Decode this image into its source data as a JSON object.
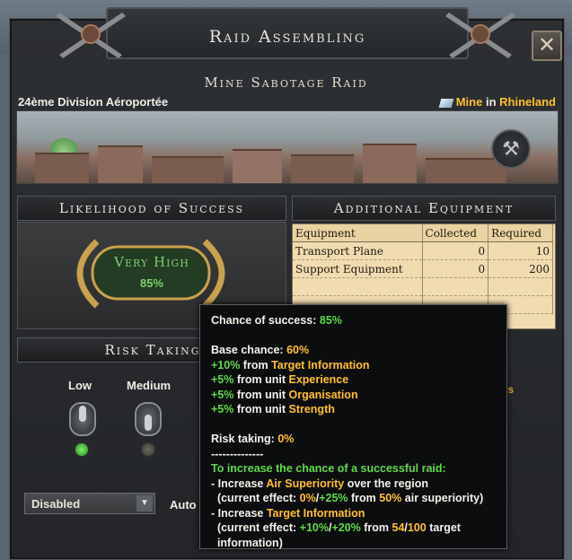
{
  "window": {
    "title": "Raid Assembling",
    "close": "✕"
  },
  "raid": {
    "name": "Mine Sabotage Raid",
    "division": "24ème Division Aéroportée",
    "target_type": "Mine",
    "target_in": "in",
    "target_region": "Rhineland"
  },
  "likelihood": {
    "header": "Likelihood of Success",
    "rating": "Very High",
    "percent": "85%"
  },
  "equipment": {
    "header": "Additional Equipment",
    "columns": [
      "Equipment",
      "Collected",
      "Required"
    ],
    "rows": [
      {
        "name": "Transport Plane",
        "collected": "0",
        "required": "10"
      },
      {
        "name": "Support Equipment",
        "collected": "0",
        "required": "200"
      }
    ]
  },
  "risk": {
    "header": "Risk Taking",
    "options": [
      {
        "label": "Low",
        "active": true
      },
      {
        "label": "Medium",
        "active": false
      }
    ],
    "fragment": "ns"
  },
  "bottom": {
    "dropdown_value": "Disabled",
    "auto_label": "Auto"
  },
  "tooltip": {
    "chance_label": "Chance of success: ",
    "chance_value": "85%",
    "base_label": "Base chance: ",
    "base_value": "60%",
    "mod1_value": "+10%",
    "mod1_from": " from ",
    "mod1_src": "Target Information",
    "mod2_value": "+5%",
    "mod2_from": " from unit ",
    "mod2_src": "Experience",
    "mod3_value": "+5%",
    "mod3_from": " from unit ",
    "mod3_src": "Organisation",
    "mod4_value": "+5%",
    "mod4_from": " from unit ",
    "mod4_src": "Strength",
    "risk_label": "Risk taking: ",
    "risk_value": "0%",
    "separator": "--------------",
    "increase_head": "To increase the chance of a successful raid:",
    "inc1_pre": "- Increase ",
    "inc1_key": "Air Superiority",
    "inc1_post": " over the region",
    "inc1_eff_pre": "  (current effect: ",
    "inc1_eff_a": "0%",
    "inc1_eff_sep": "/",
    "inc1_eff_b": "+25%",
    "inc1_eff_from": " from ",
    "inc1_eff_c": "50%",
    "inc1_eff_post": " air superiority)",
    "inc2_pre": "- Increase ",
    "inc2_key": "Target Information",
    "inc2_eff_pre": "  (current effect: ",
    "inc2_eff_a": "+10%",
    "inc2_eff_sep": "/",
    "inc2_eff_b": "+20%",
    "inc2_eff_from": " from ",
    "inc2_eff_c": "54",
    "inc2_eff_sep2": "/",
    "inc2_eff_d": "100",
    "inc2_eff_post": " target",
    "inc2_eff_tail": "  information)"
  }
}
